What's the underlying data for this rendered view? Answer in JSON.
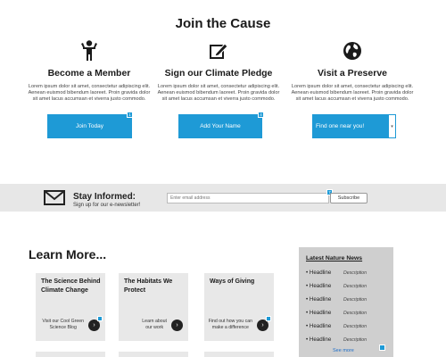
{
  "header": {
    "title": "Join the Cause"
  },
  "columns": [
    {
      "heading": "Become a Member",
      "body": "Lorem ipsum dolor sit amet, consectetur adipiscing elit. Aenean euismod bibendum laoreet. Proin gravida dolor sit amet lacus accumsan et viverra justo commodo.",
      "icon": "person-icon",
      "button": "Join Today",
      "badge": "1"
    },
    {
      "heading": "Sign our Climate Pledge",
      "body": "Lorem ipsum dolor sit amet, consectetur adipiscing elit. Aenean euismod bibendum laoreet. Proin gravida dolor sit amet lacus accumsan et viverra justo commodo.",
      "icon": "edit-pencil-icon",
      "button": "Add Your Name",
      "badge": "4"
    },
    {
      "heading": "Visit a Preserve",
      "body": "Lorem ipsum dolor sit amet, consectetur adipiscing elit. Aenean euismod bibendum laoreet. Proin gravida dolor sit amet lacus accumsan et viverra justo commodo.",
      "icon": "globe-icon",
      "select_value": "Find one near you!"
    }
  ],
  "newsletter": {
    "title": "Stay Informed:",
    "subtitle": "Sign up for our e-newsletter!",
    "email_placeholder": "Enter email address",
    "subscribe": "Subscribe",
    "badge": "7"
  },
  "learn": {
    "title": "Learn More...",
    "cards": [
      {
        "title_line1": "The Science Behind",
        "title_line2": "Climate Change",
        "link_line1": "Visit our Cool Green",
        "link_line2": "Science Blog",
        "badge": "10"
      },
      {
        "title_line1": "The Habitats We",
        "title_line2": "Protect",
        "link_line1": "Learn about",
        "link_line2": "our work"
      },
      {
        "title_line1": "Ways of Giving",
        "title_line2": "",
        "link_line1": "Find out how you can",
        "link_line2": "make a difference",
        "badge": "11"
      }
    ]
  },
  "sidebar": {
    "title": "Latest Nature News",
    "items": [
      {
        "headline": "Headline",
        "desc": "Description"
      },
      {
        "headline": "Headline",
        "desc": "Description"
      },
      {
        "headline": "Headline",
        "desc": "Description"
      },
      {
        "headline": "Headline",
        "desc": "Description"
      },
      {
        "headline": "Headline",
        "desc": "Description"
      },
      {
        "headline": "Headline",
        "desc": "Description"
      }
    ],
    "more": "See more",
    "badge": "12"
  },
  "colors": {
    "accent": "#1e9ad6",
    "band": "#e7e7e7",
    "card": "#e8e8e8",
    "sidebar": "#cfcfcf"
  }
}
